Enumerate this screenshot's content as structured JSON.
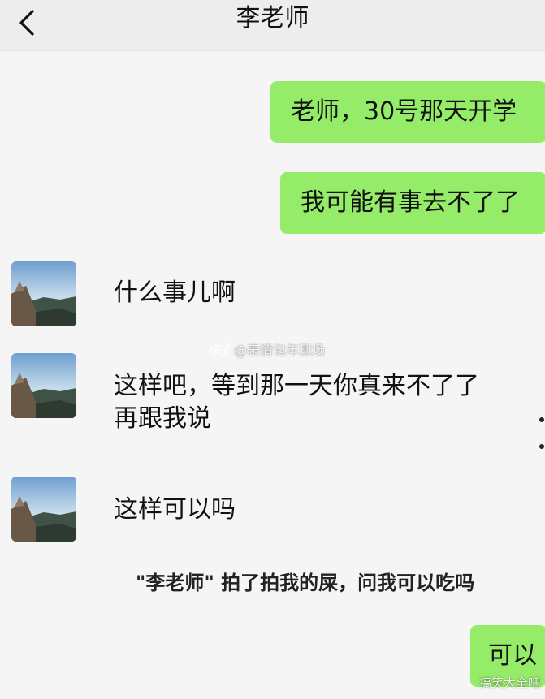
{
  "header": {
    "title": "李老师",
    "back_icon": "chevron-left-icon"
  },
  "messages": [
    {
      "side": "right",
      "text": "老师，30号那天开学"
    },
    {
      "side": "right",
      "text": "我可能有事去不了了"
    },
    {
      "side": "left",
      "text": "什么事儿啊"
    },
    {
      "side": "left",
      "lines": [
        "这样吧，等到那一天你真来不了了",
        "再跟我说"
      ]
    },
    {
      "side": "left",
      "text": "这样可以吗"
    },
    {
      "side": "right",
      "text": "可以"
    }
  ],
  "system_note": "\"李老师\" 拍了拍我的屎，问我可以吃吗",
  "watermark": {
    "text": "@表情包年现场",
    "bottom_text": "搞笑大全吧"
  },
  "colors": {
    "bubble_green": "#95ec69",
    "background": "#f5f5f5",
    "header_bg": "#ededed"
  }
}
